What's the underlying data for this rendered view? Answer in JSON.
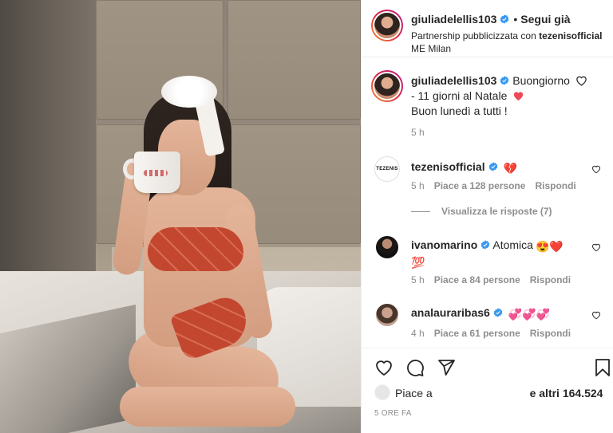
{
  "header": {
    "username": "giuliadelellis103",
    "separator": "•",
    "follow_label": "Segui già",
    "partnership_text": "Partnership pubblicizzata con ",
    "partner_name": "tezenisofficial",
    "location": "ME Milan"
  },
  "caption": {
    "username": "giuliadelellis103",
    "line1": "Buongiorno",
    "line2": "- 11 giorni al Natale",
    "line3": "Buon lunedì a tutti !",
    "time": "5 h"
  },
  "comments": [
    {
      "username": "tezenisofficial",
      "text": "",
      "emoji": "💔",
      "time": "5 h",
      "likes": "Piace a 128 persone",
      "reply_label": "Rispondi"
    },
    {
      "username": "ivanomarino",
      "text": "Atomica",
      "emoji": "😍❤️",
      "emoji2": "💯",
      "time": "5 h",
      "likes": "Piace a 84 persone",
      "reply_label": "Rispondi"
    },
    {
      "username": "analauraribas6",
      "text": "",
      "emoji": "💞💞💞",
      "time": "4 h",
      "likes": "Piace a 61 persone",
      "reply_label": "Rispondi"
    }
  ],
  "view_replies": "Visualizza le risposte (7)",
  "likes": {
    "prefix": "Piace a",
    "suffix": "e altri 164.524"
  },
  "time_ago": "5 ORE FA",
  "avatars": {
    "tezenis_logo": "TEZENIS"
  },
  "icons": {
    "like": "heart-icon",
    "comment": "comment-icon",
    "share": "share-icon",
    "save": "bookmark-icon",
    "verified": "verified-badge-icon"
  },
  "colors": {
    "verified_blue": "#3897f0",
    "heart_red": "#ed4956",
    "muted_gray": "#8e8e8e",
    "text_dark": "#262626"
  }
}
